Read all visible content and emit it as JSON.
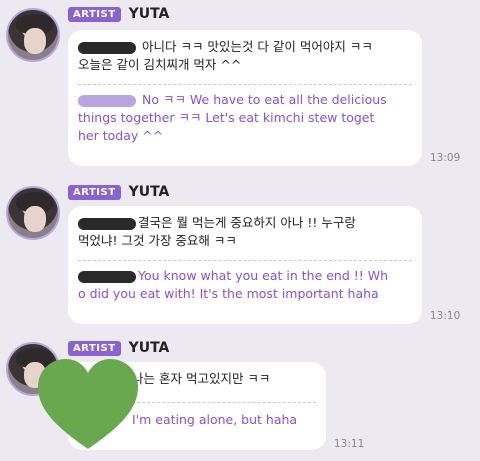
{
  "messages": [
    {
      "badge": "ARTIST",
      "name": "YUTA",
      "korean_lines": [
        "아니다 ㅋㅋ 맛있는것 다 같이 먹어야지 ㅋㅋ",
        "오늘은 같이 김치찌개 먹자 ^^"
      ],
      "english_lines": [
        "No ㅋㅋ We have to eat all the delicious",
        "things together ㅋㅋ Let's eat kimchi stew toget",
        "her today ^^"
      ],
      "time": "13:09"
    },
    {
      "badge": "ARTIST",
      "name": "YUTA",
      "korean_lines": [
        "결국은 뭘 먹는게 중요하지 아나 !! 누구랑",
        "먹었냐! 그것 가장 중요해 ㅋㅋ"
      ],
      "english_lines": [
        "You know what you eat in the end !! Wh",
        "o did you eat with! It's the most important haha"
      ],
      "time": "13:10"
    },
    {
      "badge": "ARTIST",
      "name": "YUTA",
      "korean_lines": [
        "나는 혼자 먹고있지만 ㅋㅋ"
      ],
      "english_lines": [
        "I'm eating alone, but haha"
      ],
      "time": "13:11"
    }
  ],
  "colors": {
    "background": "#ece9f1",
    "badge": "#8a63d2",
    "translation_text": "#8a4fd8",
    "heart_sticker": "#6aa84f"
  },
  "icons": [
    "avatar",
    "heart-sticker"
  ]
}
